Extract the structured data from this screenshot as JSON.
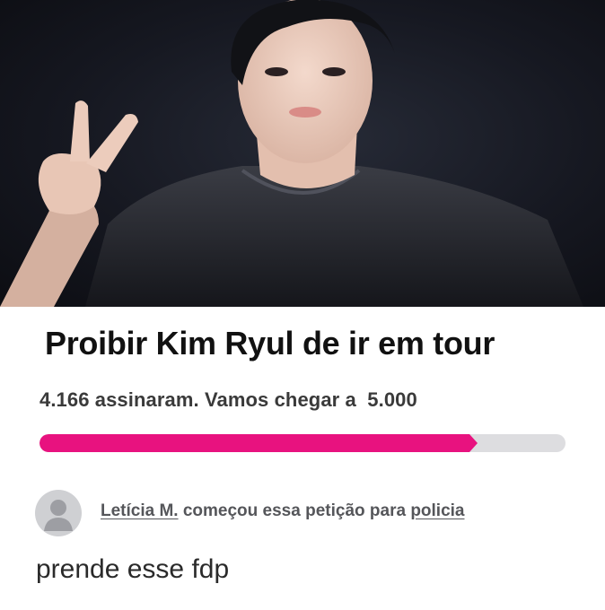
{
  "petition": {
    "title": "Proibir Kim Ryul de ir em tour",
    "signatures_text": "4.166 assinaram. Vamos chegar a  5.000",
    "signed_count": 4166,
    "goal_count": 5000,
    "progress_fraction": 0.8332,
    "progress_color": "#e8127f",
    "starter_name": "Letícia M.",
    "starter_middle": " começou essa petição para ",
    "starter_target": "policia"
  },
  "comment": {
    "text": "prende esse fdp"
  },
  "photo": {
    "icon": "person-peace-sign-photo"
  }
}
